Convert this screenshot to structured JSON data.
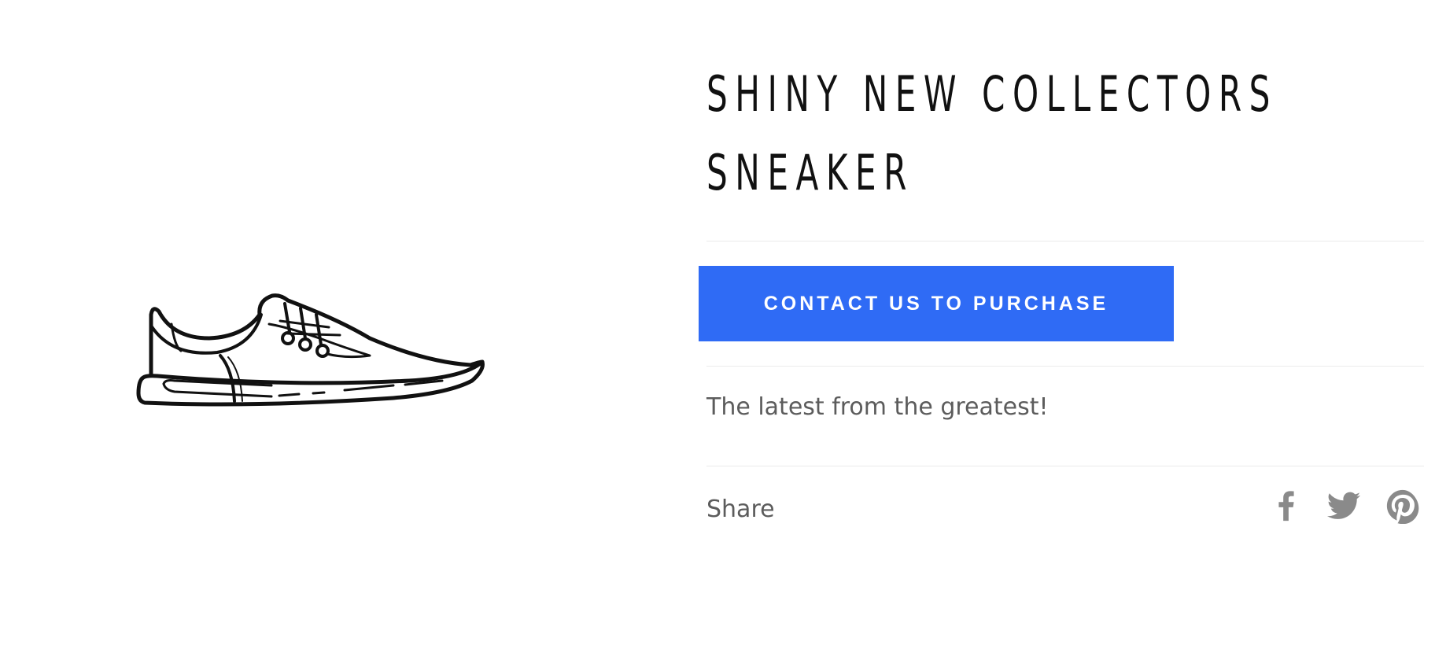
{
  "product": {
    "title": "SHINY NEW COLLECTORS SNEAKER",
    "image_icon": "sneaker-illustration",
    "cta_label": "CONTACT US TO PURCHASE",
    "description": "The latest from the greatest!"
  },
  "share": {
    "label": "Share",
    "networks": [
      "facebook-icon",
      "twitter-icon",
      "pinterest-icon"
    ]
  },
  "colors": {
    "accent": "#2f6bf5",
    "muted_text": "#5c5c5c",
    "icon": "#8a8a8a"
  }
}
